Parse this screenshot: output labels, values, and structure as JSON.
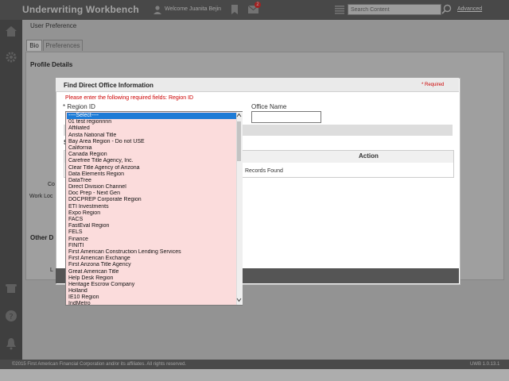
{
  "header": {
    "app_title": "Underwriting Workbench",
    "welcome": "Welcome Juanita Bejin",
    "mail_count": "2",
    "search_placeholder": "Search Content",
    "advanced_link": "Advanced"
  },
  "page": {
    "section_title": "User Preference",
    "tabs": [
      "Bio",
      "Preferences"
    ],
    "profile_details": "Profile Details",
    "other_d_fragment": "Other D",
    "co_fragment": "Co",
    "work_loc_fragment": "Work Loc",
    "l_fragment": "L"
  },
  "modal": {
    "title": "Find Direct Office Information",
    "required_note": "* Required",
    "required_message": "Please enter the following required fields: Region ID",
    "region_label": "* Region ID",
    "office_label": "Office Name",
    "s_fragment": "S",
    "action_header": "Action",
    "records_found": "Records Found"
  },
  "region_select": {
    "selected": "----Select----",
    "options": [
      "----Select----",
      "01 test regionnnn",
      "Affiliated",
      "Arista National Title",
      "Bay Area Region - Do not USE",
      "California",
      "Canada Region",
      "Carefree Title Agency, Inc.",
      "Clear Title Agency of Arizona",
      "Data Elements Region",
      "DataTree",
      "Direct Division Channel",
      "Doc Prep - Next Gen",
      "DOCPREP Corporate Region",
      "ETI Investments",
      "Expo Region",
      "FACS",
      "FastEval Region",
      "FELS",
      "Finance",
      "FINITI",
      "First American Construction Lending Services",
      "First American Exchange",
      "First Arizona Title Agency",
      "Great American Title",
      "Help Desk Region",
      "Heritage Escrow Company",
      "Holland",
      "IE10 Region",
      "IndMetro"
    ]
  },
  "footer": {
    "copyright": "©2015 First American Financial Corporation and/or its affiliates. All rights reserved.",
    "version": "UWB 1.0.13.1"
  }
}
